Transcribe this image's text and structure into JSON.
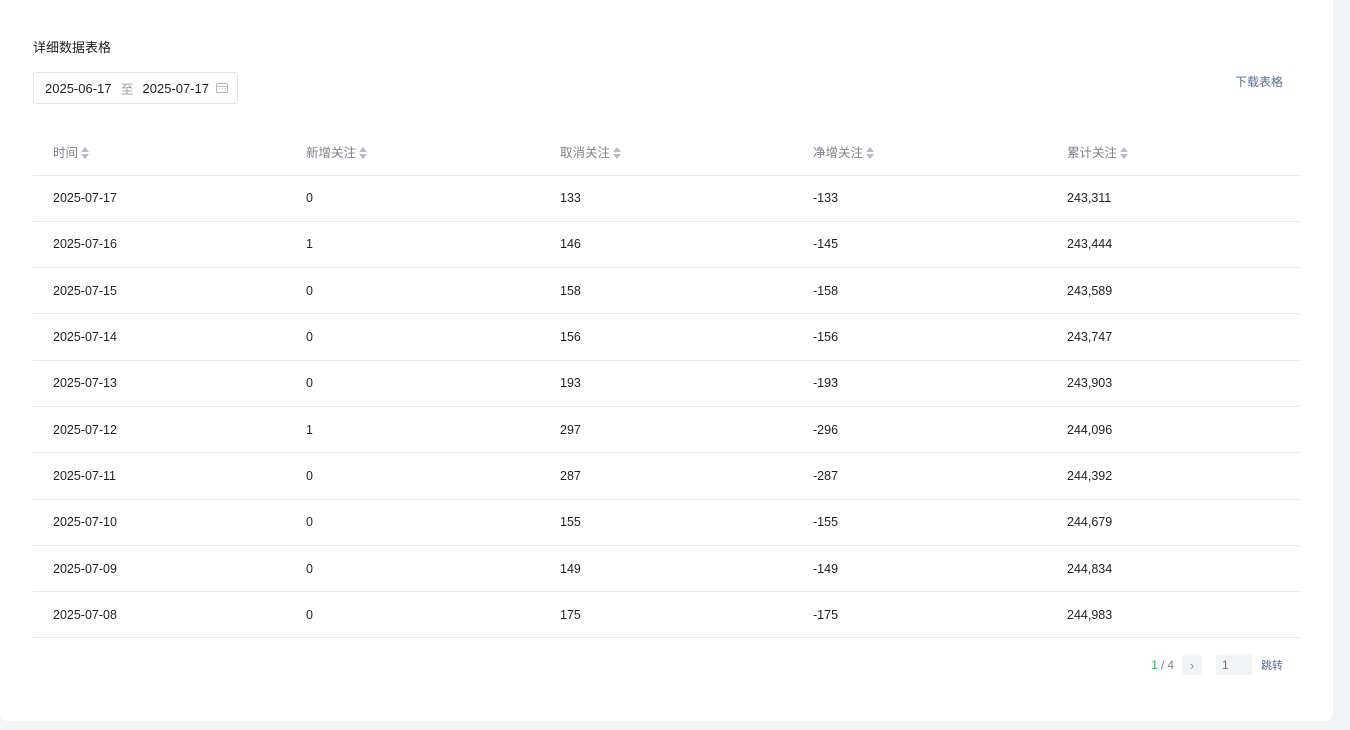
{
  "section": {
    "title": "详细数据表格"
  },
  "date_range": {
    "start": "2025-06-17",
    "separator": "至",
    "end": "2025-07-17"
  },
  "download_label": "下载表格",
  "table": {
    "columns": [
      "时间",
      "新增关注",
      "取消关注",
      "净增关注",
      "累计关注"
    ],
    "rows": [
      [
        "2025-07-17",
        "0",
        "133",
        "-133",
        "243,311"
      ],
      [
        "2025-07-16",
        "1",
        "146",
        "-145",
        "243,444"
      ],
      [
        "2025-07-15",
        "0",
        "158",
        "-158",
        "243,589"
      ],
      [
        "2025-07-14",
        "0",
        "156",
        "-156",
        "243,747"
      ],
      [
        "2025-07-13",
        "0",
        "193",
        "-193",
        "243,903"
      ],
      [
        "2025-07-12",
        "1",
        "297",
        "-296",
        "244,096"
      ],
      [
        "2025-07-11",
        "0",
        "287",
        "-287",
        "244,392"
      ],
      [
        "2025-07-10",
        "0",
        "155",
        "-155",
        "244,679"
      ],
      [
        "2025-07-09",
        "0",
        "149",
        "-149",
        "244,834"
      ],
      [
        "2025-07-08",
        "0",
        "175",
        "-175",
        "244,983"
      ]
    ]
  },
  "pagination": {
    "current": "1",
    "separator": "/",
    "total": "4",
    "next_icon": "›",
    "input_placeholder": "1",
    "jump_label": "跳转"
  },
  "colors": {
    "accent_green": "#07c160",
    "link_blue": "#576b95"
  }
}
